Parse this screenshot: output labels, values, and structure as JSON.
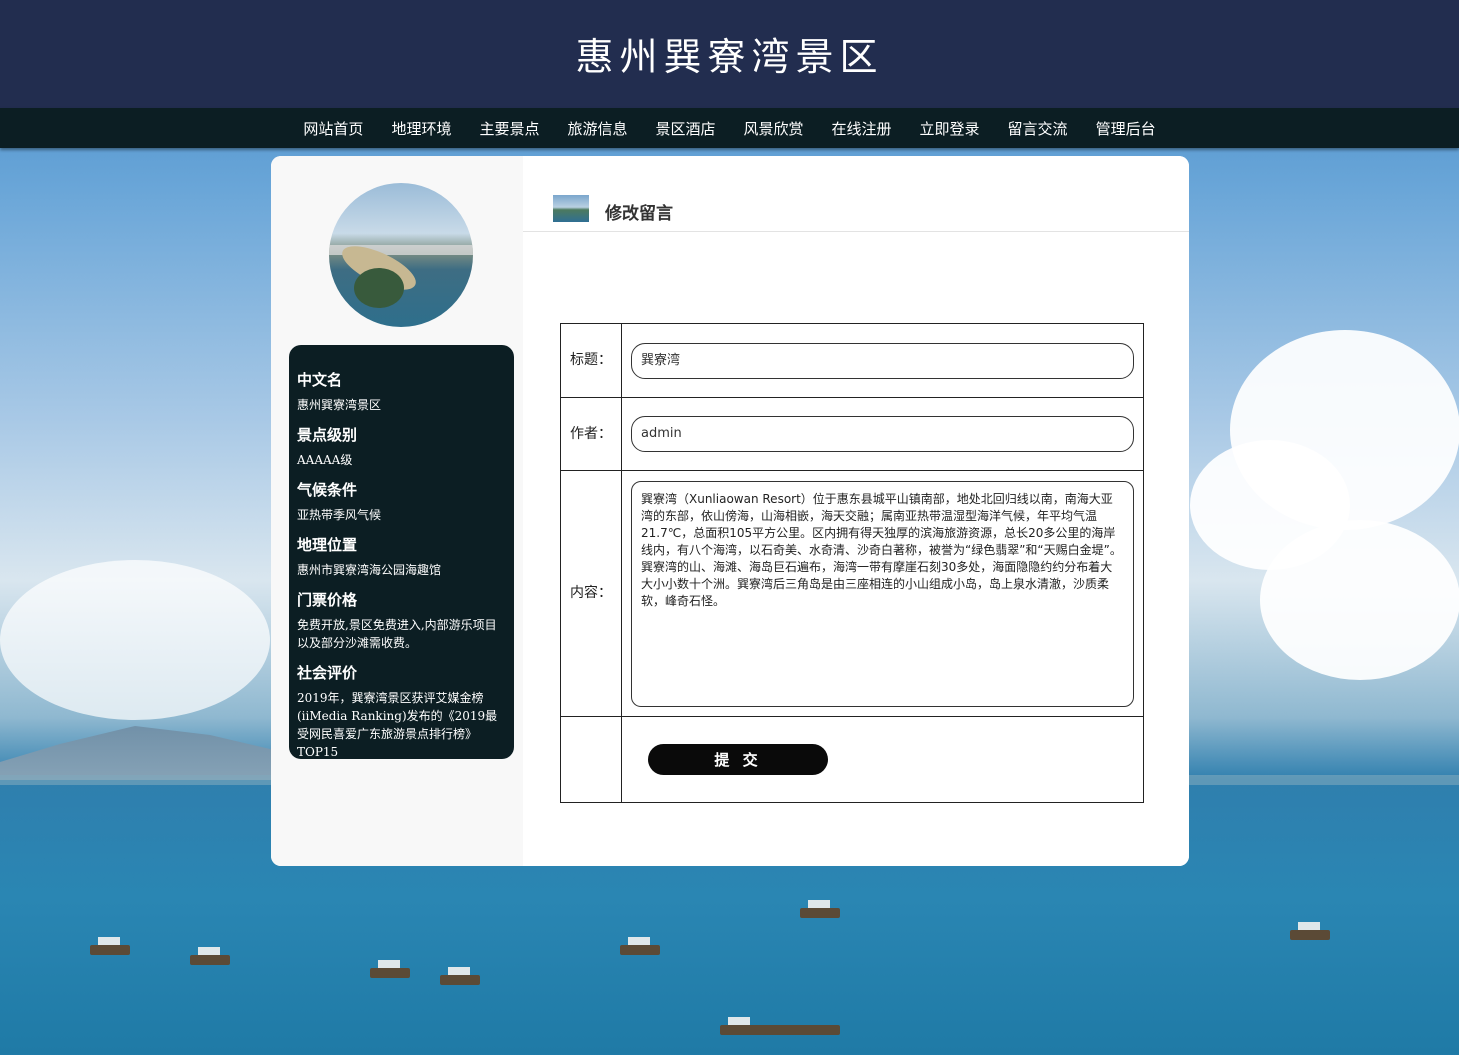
{
  "site_title": "惠州巽寮湾景区",
  "nav": [
    {
      "label": "网站首页"
    },
    {
      "label": "地理环境"
    },
    {
      "label": "主要景点"
    },
    {
      "label": "旅游信息"
    },
    {
      "label": "景区酒店"
    },
    {
      "label": "风景欣赏"
    },
    {
      "label": "在线注册"
    },
    {
      "label": "立即登录"
    },
    {
      "label": "留言交流"
    },
    {
      "label": "管理后台"
    }
  ],
  "sidebar": {
    "items": [
      {
        "heading": "中文名",
        "value": "惠州巽寮湾景区"
      },
      {
        "heading": "景点级别",
        "value": "AAAAA级"
      },
      {
        "heading": "气候条件",
        "value": "亚热带季风气候"
      },
      {
        "heading": "地理位置",
        "value": "惠州市巽寮湾海公园海趣馆"
      },
      {
        "heading": "门票价格",
        "value": "免费开放,景区免费进入,内部游乐项目以及部分沙滩需收费。"
      },
      {
        "heading": "社会评价",
        "value": "2019年，巽寮湾景区获评艾媒金榜(iiMedia Ranking)发布的《2019最受网民喜爱广东旅游景点排行榜》TOP15"
      }
    ]
  },
  "content": {
    "title": "修改留言",
    "form": {
      "title_label": "标题：",
      "title_value": "巽寮湾",
      "author_label": "作者：",
      "author_value": "admin",
      "content_label": "内容：",
      "content_value": "巽寮湾（Xunliaowan Resort）位于惠东县城平山镇南部，地处北回归线以南，南海大亚湾的东部，依山傍海，山海相嵌，海天交融；属南亚热带温湿型海洋气候，年平均气温21.7℃，总面积105平方公里。区内拥有得天独厚的滨海旅游资源，总长20多公里的海岸线内，有八个海湾，以石奇美、水奇清、沙奇白著称，被誉为“绿色翡翠”和“天赐白金堤”。巽寮湾的山、海滩、海岛巨石遍布，海湾一带有摩崖石刻30多处，海面隐隐约约分布着大大小小数十个洲。巽寮湾后三角岛是由三座相连的小山组成小岛，岛上泉水清澈，沙质柔软，峰奇石怪。",
      "submit_label": "提 交"
    }
  }
}
